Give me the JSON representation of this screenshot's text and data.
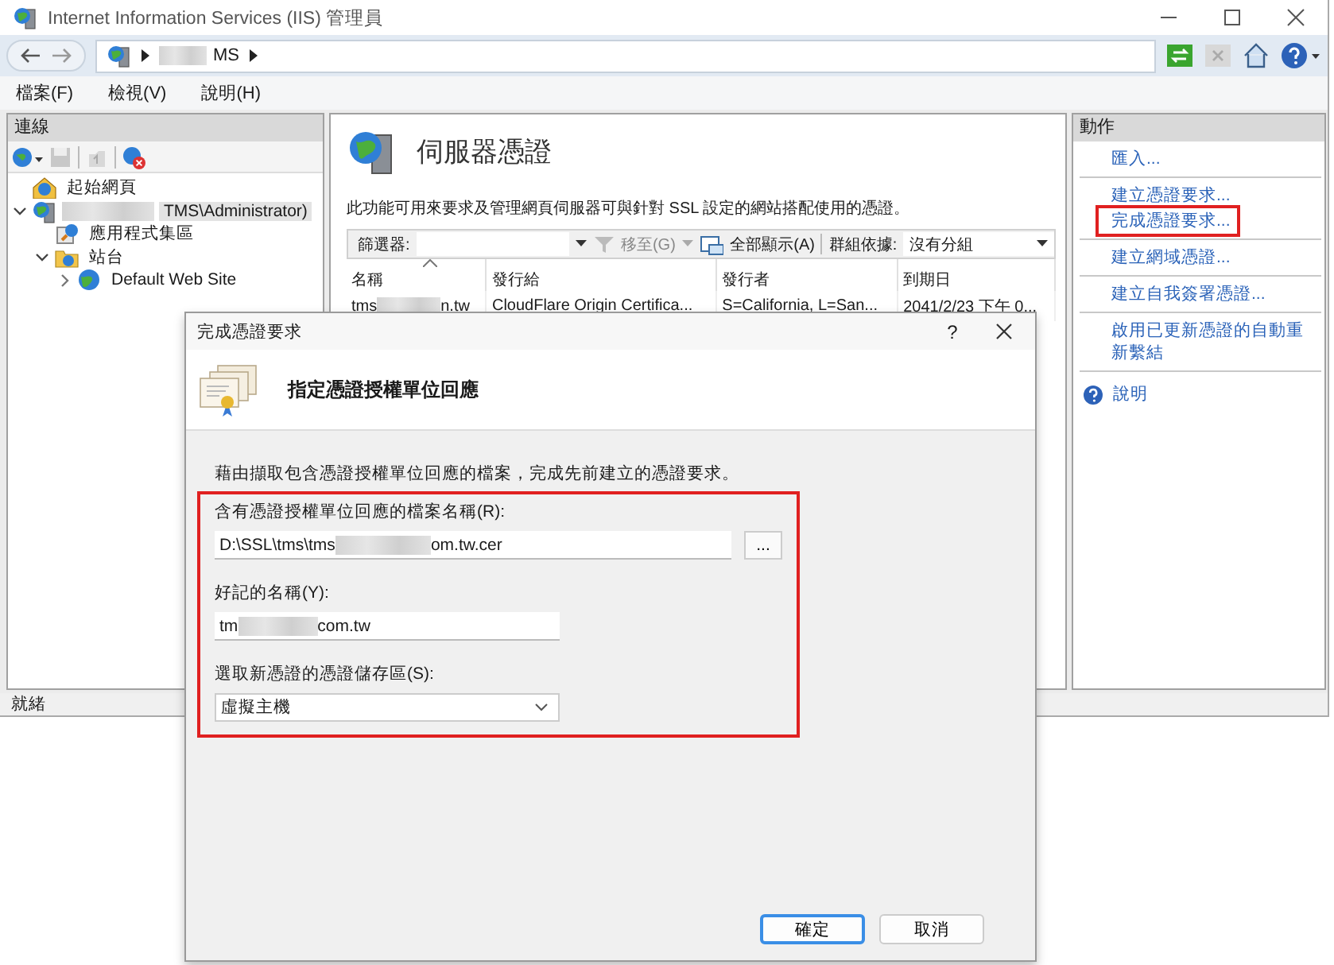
{
  "window": {
    "title": "Internet Information Services (IIS) 管理員"
  },
  "address_bar": {
    "segments": [
      {
        "label": "MS",
        "blurred_prefix": true
      }
    ]
  },
  "menu": [
    {
      "label": "檔案(F)"
    },
    {
      "label": "檢視(V)"
    },
    {
      "label": "說明(H)"
    }
  ],
  "connections": {
    "title": "連線",
    "tree": [
      {
        "label": "起始網頁",
        "kind": "home",
        "selected": false
      },
      {
        "label": "TMS\\Administrator)",
        "kind": "server",
        "blurred_prefix": true,
        "selected": true,
        "expanded": true,
        "children": [
          {
            "label": "應用程式集區",
            "kind": "pools",
            "selected": false
          },
          {
            "label": "站台",
            "kind": "sites",
            "selected": false,
            "expanded": true,
            "children": [
              {
                "label": "Default Web Site",
                "kind": "site",
                "selected": false,
                "expanded": false
              }
            ]
          }
        ]
      }
    ]
  },
  "center": {
    "title": "伺服器憑證",
    "description": "此功能可用來要求及管理網頁伺服器可與針對 SSL 設定的網站搭配使用的憑證。",
    "toolbar": {
      "filter_label": "篩選器:",
      "goto": "移至(G)",
      "show_all": "全部顯示(A)",
      "group_label": "群組依據:",
      "group_value": "沒有分組"
    },
    "table": {
      "columns": [
        "名稱",
        "發行給",
        "發行者",
        "到期日"
      ],
      "rows": [
        {
          "name_parts": [
            "tms",
            "n.tw"
          ],
          "issued_to": "CloudFlare Origin Certifica...",
          "issuer": "S=California, L=San...",
          "expires": "2041/2/23 下午 0..."
        }
      ]
    }
  },
  "actions": {
    "title": "動作",
    "groups": [
      [
        {
          "label": "匯入...",
          "kind": "link",
          "highlighted": false
        }
      ],
      [
        {
          "label": "建立憑證要求...",
          "kind": "link",
          "highlighted": false
        },
        {
          "label": "完成憑證要求...",
          "kind": "link",
          "highlighted": true
        }
      ],
      [
        {
          "label": "建立網域憑證...",
          "kind": "link",
          "highlighted": false
        }
      ],
      [
        {
          "label": "建立自我簽署憑證...",
          "kind": "link",
          "highlighted": false
        }
      ],
      [
        {
          "label": "啟用已更新憑證的自動重新繫結",
          "kind": "link",
          "highlighted": false
        }
      ],
      [
        {
          "label": "說明",
          "kind": "help",
          "highlighted": false
        }
      ]
    ]
  },
  "status_bar": {
    "text": "就緒"
  },
  "dialog": {
    "title": "完成憑證要求",
    "help": "?",
    "heading": "指定憑證授權單位回應",
    "description": "藉由擷取包含憑證授權單位回應的檔案，完成先前建立的憑證要求。",
    "fields_highlighted": true,
    "fields": [
      {
        "kind": "file",
        "label": "含有憑證授權單位回應的檔案名稱(R):",
        "value_parts": [
          "D:\\SSL\\tms\\tms",
          "om.tw.cer"
        ],
        "browse": "..."
      },
      {
        "kind": "text",
        "label": "好記的名稱(Y):",
        "value_parts": [
          "tm",
          "com.tw"
        ]
      },
      {
        "kind": "select",
        "label": "選取新憑證的憑證儲存區(S):",
        "value_parts": [
          "虛擬主機"
        ]
      }
    ],
    "buttons": [
      {
        "label": "確定",
        "default": true
      },
      {
        "label": "取消",
        "default": false
      }
    ]
  }
}
